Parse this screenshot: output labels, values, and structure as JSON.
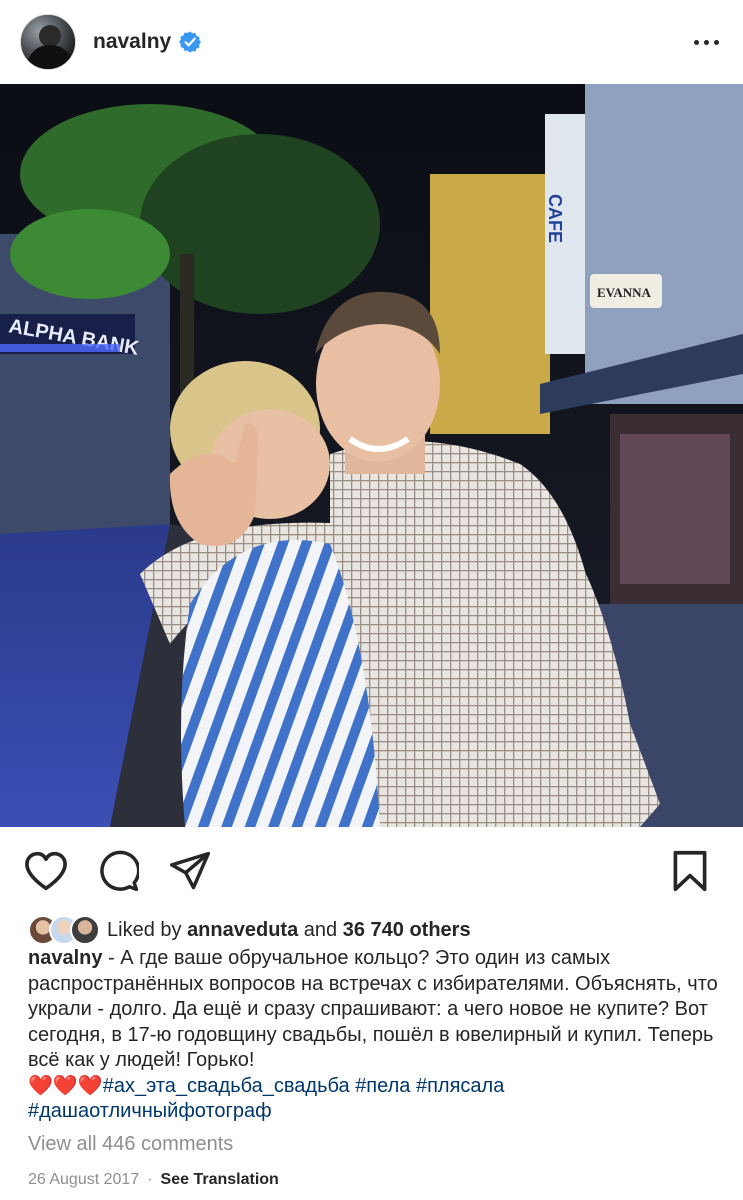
{
  "post": {
    "username": "navalny",
    "verified": true,
    "icons": {
      "menu": "more-dots-icon",
      "like": "heart-outline-icon",
      "comment": "comment-bubble-icon",
      "share": "paper-plane-icon",
      "save": "bookmark-icon",
      "verified": "verified-badge-icon"
    },
    "photo_signs": {
      "bank": "ALPHA BANK",
      "cafe": "CAFE",
      "shop": "EVANNA"
    },
    "likes": {
      "prefix": "Liked by",
      "user": "annaveduta",
      "joiner": "and",
      "others": "36 740 others"
    },
    "caption": {
      "username": "navalny",
      "text": " - А где ваше обручальное кольцо? Это один из самых распространённых вопросов на встречах с избирателями. Объяснять, что украли - долго. Да ещё и сразу спрашивают: а чего новое не купите? Вот сегодня, в 17-ю годовщину свадьбы, пошёл в ювелирный и купил. Теперь всё как у людей! Горько!",
      "hearts": "❤️❤️❤️",
      "tags": [
        "#ах_эта_свадьба_свадьба",
        "#пела",
        "#плясала",
        "#дашаотличныйфотограф"
      ]
    },
    "comments_link": "View all 446 comments",
    "date": "26 August 2017",
    "separator": "·",
    "translate": "See Translation"
  },
  "colors": {
    "verified": "#3897f0",
    "link": "#00376b",
    "secondary": "#8e8e8e",
    "heart": "#ed4956"
  }
}
